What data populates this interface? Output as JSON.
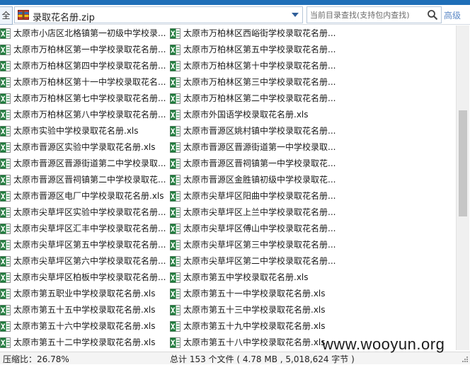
{
  "toolbar": {
    "all_label": "全",
    "path": "录取花名册.zip",
    "search_placeholder": "当前目录查找(支持包内查找)",
    "advanced_label": "高级"
  },
  "files": [
    [
      "太原市小店区北格镇第一初级中学校录...",
      "太原市万柏林区西峪街学校录取花名册..."
    ],
    [
      "太原市万柏林区第一中学校录取花名册...",
      "太原市万柏林区第五中学校录取花名册..."
    ],
    [
      "太原市万柏林区第四中学校录取花名册...",
      "太原市万柏林区第十中学校录取花名册..."
    ],
    [
      "太原市万柏林区第十一中学校录取花名...",
      "太原市万柏林区第三中学校录取花名册..."
    ],
    [
      "太原市万柏林区第七中学校录取花名册...",
      "太原市万柏林区第二中学校录取花名册..."
    ],
    [
      "太原市万柏林区第八中学校录取花名册...",
      "太原市外国语学校录取花名册.xls"
    ],
    [
      "太原市实验中学校录取花名册.xls",
      "太原市晋源区姚村镇中学校录取花名册..."
    ],
    [
      "太原市晋源区实验中学录取花名册.xls",
      "太原市晋源区晋源街道第一中学校录取..."
    ],
    [
      "太原市晋源区晋源街道第二中学校录取...",
      "太原市晋源区晋祠镇第一中学校录取花..."
    ],
    [
      "太原市晋源区晋祠镇第二中学校录取花...",
      "太原市晋源区金胜镇初级中学校录取花..."
    ],
    [
      "太原市晋源区电厂中学校录取花名册.xls",
      "太原市尖草坪区阳曲中学校录取花名册..."
    ],
    [
      "太原市尖草坪区实验中学校录取花名册...",
      "太原市尖草坪区上兰中学校录取花名册..."
    ],
    [
      "太原市尖草坪区汇丰中学校录取花名册...",
      "太原市尖草坪区傅山中学校录取花名册..."
    ],
    [
      "太原市尖草坪区第五中学校录取花名册...",
      "太原市尖草坪区第三中学校录取花名册..."
    ],
    [
      "太原市尖草坪区第六中学校录取花名册...",
      "太原市尖草坪区第二中学校录取花名册..."
    ],
    [
      "太原市尖草坪区柏板中学校录取花名册...",
      "太原市第五中学校录取花名册.xls"
    ],
    [
      "太原市第五职业中学校录取花名册.xls",
      "太原市第五十一中学校录取花名册.xls"
    ],
    [
      "太原市第五十五中学校录取花名册.xls",
      "太原市第五十三中学校录取花名册.xls"
    ],
    [
      "太原市第五十六中学校录取花名册.xls",
      "太原市第五十九中学校录取花名册.xls"
    ],
    [
      "太原市第五十二中学校录取花名册.xls",
      "太原市第五十八中学校录取花名册.xls"
    ]
  ],
  "status": {
    "ratio": "压缩比：26.78%",
    "total": "总计 153 个文件 ( 4.78 MB , 5,018,624 字节 )"
  },
  "watermark": "www.wooyun.org",
  "icons": {
    "excel_file": "excel-icon",
    "archive": "zip-icon",
    "search": "search-icon"
  },
  "colors": {
    "excel_green": "#1d7a3a",
    "accent": "#1f6fb8",
    "link": "#5b88c6"
  }
}
